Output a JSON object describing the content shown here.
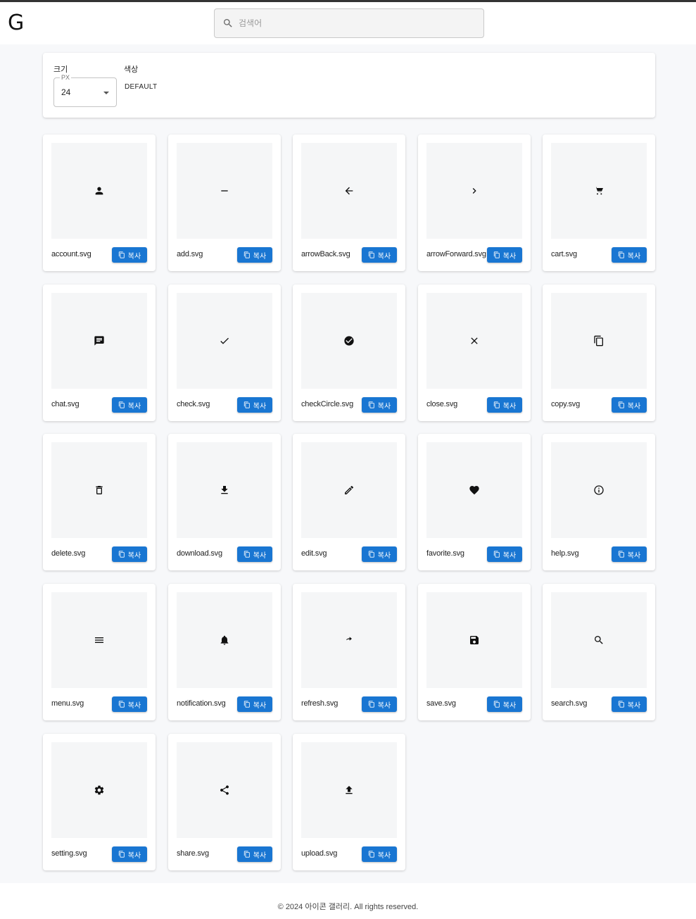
{
  "header": {
    "logo": "G",
    "search_placeholder": "검색어"
  },
  "controls": {
    "size_label": "크기",
    "size_legend": "PX",
    "size_value": "24",
    "color_label": "색상",
    "color_value": "DEFAULT"
  },
  "copy_label": "복사",
  "icons": [
    {
      "file": "account.svg",
      "icon": "person-icon"
    },
    {
      "file": "add.svg",
      "icon": "minus-icon"
    },
    {
      "file": "arrowBack.svg",
      "icon": "arrow-back-icon"
    },
    {
      "file": "arrowForward.svg",
      "icon": "chevron-right-icon"
    },
    {
      "file": "cart.svg",
      "icon": "cart-icon"
    },
    {
      "file": "chat.svg",
      "icon": "chat-icon"
    },
    {
      "file": "check.svg",
      "icon": "check-icon"
    },
    {
      "file": "checkCircle.svg",
      "icon": "check-circle-icon"
    },
    {
      "file": "close.svg",
      "icon": "close-icon"
    },
    {
      "file": "copy.svg",
      "icon": "copy-icon"
    },
    {
      "file": "delete.svg",
      "icon": "trash-icon"
    },
    {
      "file": "download.svg",
      "icon": "download-icon"
    },
    {
      "file": "edit.svg",
      "icon": "pencil-icon"
    },
    {
      "file": "favorite.svg",
      "icon": "heart-icon"
    },
    {
      "file": "help.svg",
      "icon": "info-icon"
    },
    {
      "file": "menu.svg",
      "icon": "menu-icon"
    },
    {
      "file": "notification.svg",
      "icon": "bell-icon"
    },
    {
      "file": "refresh.svg",
      "icon": "refresh-icon"
    },
    {
      "file": "save.svg",
      "icon": "save-icon"
    },
    {
      "file": "search.svg",
      "icon": "search-icon"
    },
    {
      "file": "setting.svg",
      "icon": "gear-icon"
    },
    {
      "file": "share.svg",
      "icon": "share-icon"
    },
    {
      "file": "upload.svg",
      "icon": "upload-icon"
    }
  ],
  "footer": {
    "text": "© 2024 아이콘 갤러리. All rights reserved."
  },
  "colors": {
    "accent": "#1976d2",
    "background": "#f7f8fa",
    "preview_bg": "#f5f6f7"
  }
}
